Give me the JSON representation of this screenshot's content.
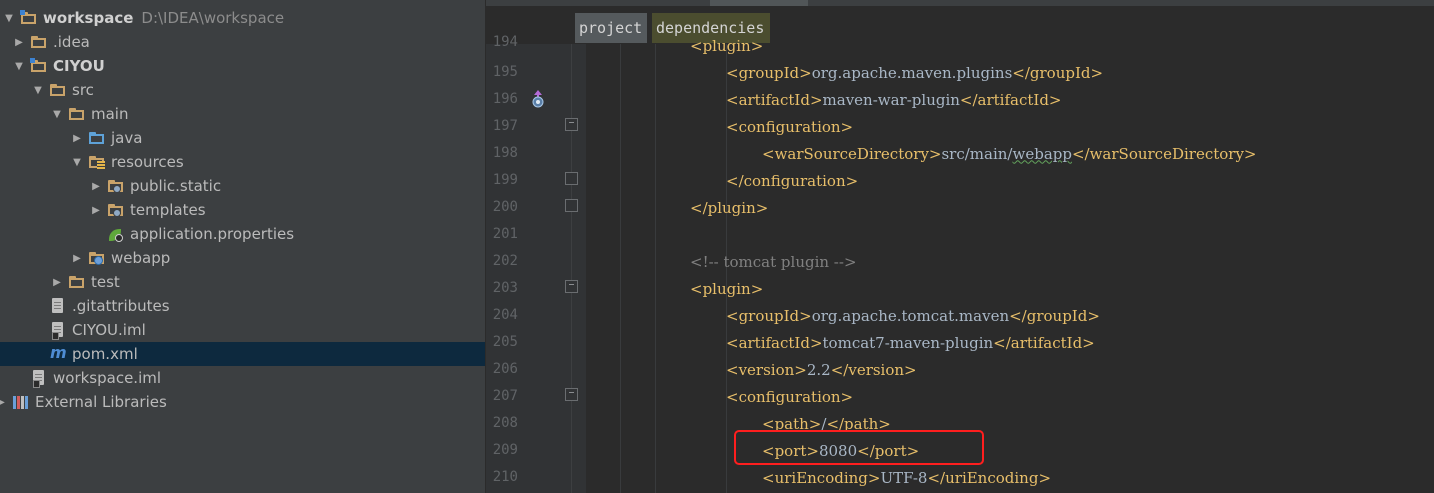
{
  "project_tree": {
    "items": [
      {
        "label": "workspace",
        "path": "D:\\IDEA\\workspace"
      },
      {
        "label": ".idea"
      },
      {
        "label": "CIYOU"
      },
      {
        "label": "src"
      },
      {
        "label": "main"
      },
      {
        "label": "java"
      },
      {
        "label": "resources"
      },
      {
        "label": "public.static"
      },
      {
        "label": "templates"
      },
      {
        "label": "application.properties"
      },
      {
        "label": "webapp"
      },
      {
        "label": "test"
      },
      {
        "label": ".gitattributes"
      },
      {
        "label": "CIYOU.iml"
      },
      {
        "label": "pom.xml"
      },
      {
        "label": "workspace.iml"
      },
      {
        "label": "External Libraries"
      }
    ]
  },
  "editor": {
    "breadcrumbs": [
      "project",
      "dependencies"
    ],
    "line_numbers": [
      "194",
      "195",
      "196",
      "197",
      "198",
      "199",
      "200",
      "201",
      "202",
      "203",
      "204",
      "205",
      "206",
      "207",
      "208",
      "209",
      "210"
    ],
    "lines": {
      "l195": {
        "open": "<groupId>",
        "value": "org.apache.maven.plugins",
        "close": "</groupId>"
      },
      "l196": {
        "open": "<artifactId>",
        "value": "maven-war-plugin",
        "close": "</artifactId>"
      },
      "l197": {
        "open": "<configuration>"
      },
      "l198": {
        "open": "<warSourceDirectory>",
        "value_a": "src/main/",
        "value_b": "webapp",
        "close": "</warSourceDirectory>"
      },
      "l199": {
        "close": "</configuration>"
      },
      "l200": {
        "close": "</plugin>"
      },
      "l202": {
        "comment": "<!-- tomcat plugin -->"
      },
      "l203": {
        "open": "<plugin>"
      },
      "l204": {
        "open": "<groupId>",
        "value": "org.apache.tomcat.maven",
        "close": "</groupId>"
      },
      "l205": {
        "open": "<artifactId>",
        "value": "tomcat7-maven-plugin",
        "close": "</artifactId>"
      },
      "l206": {
        "open": "<version>",
        "value": "2.2",
        "close": "</version>"
      },
      "l207": {
        "open": "<configuration>"
      },
      "l208": {
        "open": "<path>",
        "value": "/",
        "close": "</path>"
      },
      "l209": {
        "open": "<port>",
        "value": "8080",
        "close": "</port>"
      },
      "l210": {
        "open": "<uriEncoding>",
        "value": "UTF-8",
        "close": "</uriEncoding>"
      }
    }
  },
  "colors": {
    "tree_bg": "#3c3f41",
    "editor_bg": "#2b2b2b",
    "xml_tag": "#e8bf6a",
    "text": "#a9b7c6",
    "comment": "#808080",
    "highlight_box": "#ff1e1e"
  },
  "icons": [
    "folder-icon",
    "module-folder-icon",
    "source-folder-icon",
    "resources-folder-icon",
    "web-folder-icon",
    "spring-properties-icon",
    "text-file-icon",
    "iml-file-icon",
    "maven-pom-icon",
    "libraries-icon",
    "maven-plugin-gutter-icon"
  ]
}
